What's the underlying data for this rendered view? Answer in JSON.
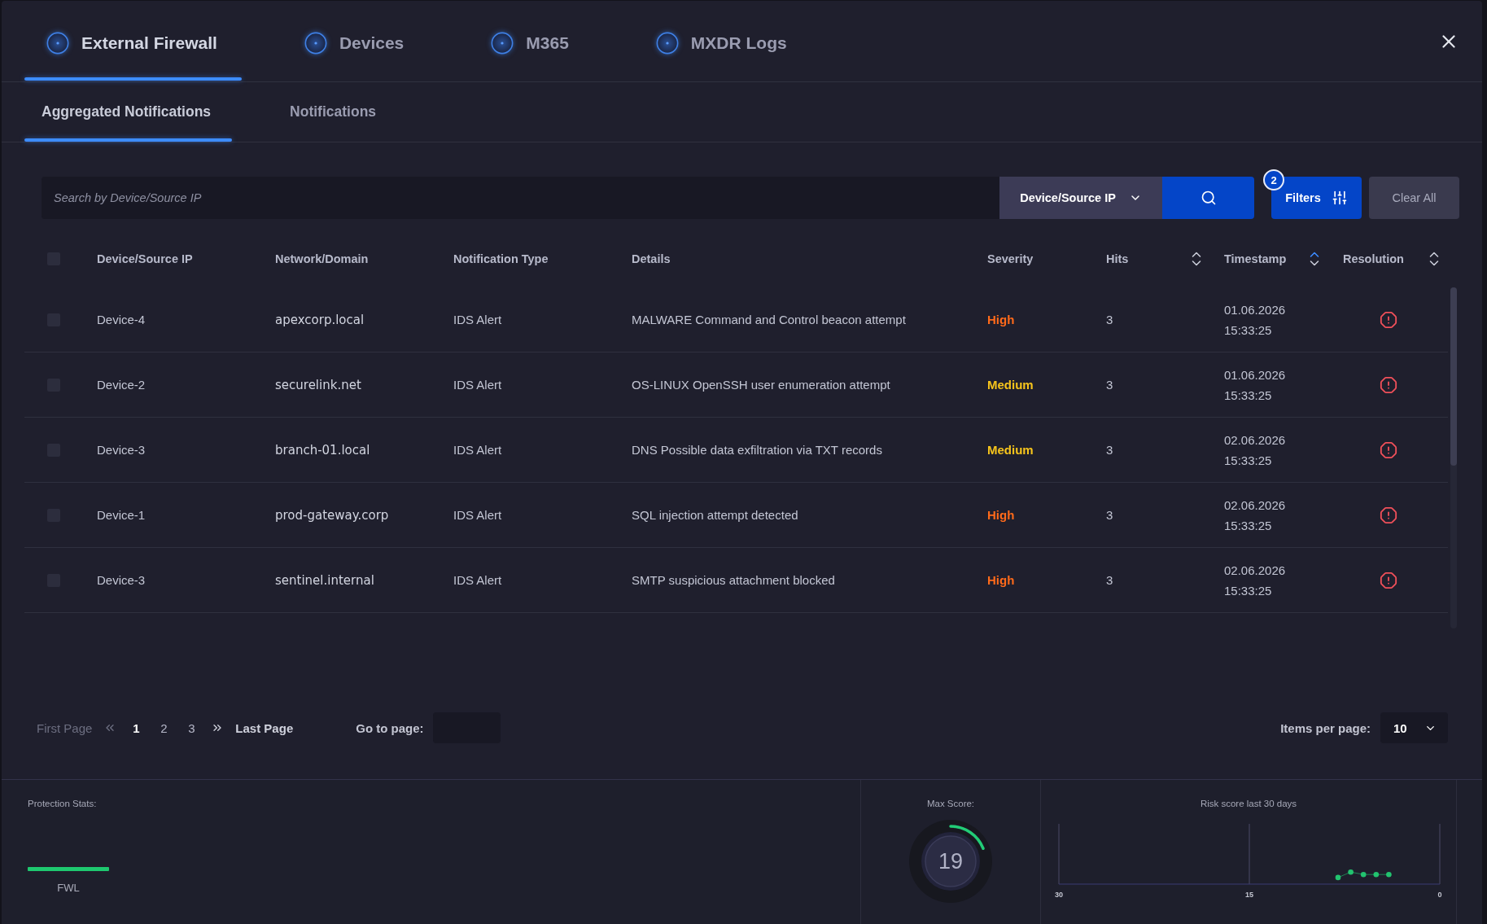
{
  "tabs": [
    {
      "label": "External Firewall",
      "selected": true
    },
    {
      "label": "Devices",
      "selected": false
    },
    {
      "label": "M365",
      "selected": false
    },
    {
      "label": "MXDR Logs",
      "selected": false
    }
  ],
  "subtabs": [
    {
      "label": "Aggregated Notifications",
      "selected": true
    },
    {
      "label": "Notifications",
      "selected": false
    }
  ],
  "search": {
    "placeholder": "Search by Device/Source IP",
    "field_select": "Device/Source IP"
  },
  "filters": {
    "label": "Filters",
    "count": "2"
  },
  "clear_button": "Clear All",
  "table": {
    "select_all": {
      "checked": false
    },
    "columns": [
      {
        "label": "Device/Source IP",
        "sortable": false
      },
      {
        "label": "Network/Domain",
        "sortable": false
      },
      {
        "label": "Notification Type",
        "sortable": false
      },
      {
        "label": "Details",
        "sortable": false
      },
      {
        "label": "Severity",
        "sortable": false
      },
      {
        "label": "Hits",
        "sortable": true,
        "sorted": false
      },
      {
        "label": "Timestamp",
        "sortable": true,
        "sorted": true
      },
      {
        "label": "Resolution",
        "sortable": true,
        "sorted": false
      }
    ],
    "rows": [
      {
        "checked": false,
        "device": "Device-4",
        "domain": "apexcorp.local",
        "type": "IDS Alert",
        "details": "MALWARE Command and Control beacon attempt",
        "severity": {
          "label": "High",
          "color": "#ff6a1a"
        },
        "hits": "3",
        "date": "01.06.2026",
        "time": "15:33:25",
        "resolved": false
      },
      {
        "checked": false,
        "device": "Device-2",
        "domain": "securelink.net",
        "type": "IDS Alert",
        "details": "OS-LINUX OpenSSH user enumeration attempt",
        "severity": {
          "label": "Medium",
          "color": "#f7c51c"
        },
        "hits": "3",
        "date": "01.06.2026",
        "time": "15:33:25",
        "resolved": false
      },
      {
        "checked": false,
        "device": "Device-3",
        "domain": "branch-01.local",
        "type": "IDS Alert",
        "details": "DNS Possible data exfiltration via TXT records",
        "severity": {
          "label": "Medium",
          "color": "#f7c51c"
        },
        "hits": "3",
        "date": "02.06.2026",
        "time": "15:33:25",
        "resolved": false
      },
      {
        "checked": false,
        "device": "Device-1",
        "domain": "prod-gateway.corp",
        "type": "IDS Alert",
        "details": "SQL injection attempt detected",
        "severity": {
          "label": "High",
          "color": "#ff6a1a"
        },
        "hits": "3",
        "date": "02.06.2026",
        "time": "15:33:25",
        "resolved": false
      },
      {
        "checked": false,
        "device": "Device-3",
        "domain": "sentinel.internal",
        "type": "IDS Alert",
        "details": "SMTP suspicious attachment blocked",
        "severity": {
          "label": "High",
          "color": "#ff6a1a"
        },
        "hits": "3",
        "date": "02.06.2026",
        "time": "15:33:25",
        "resolved": false
      }
    ]
  },
  "pagination": {
    "first": {
      "label": "First Page",
      "disabled": true
    },
    "pages": [
      {
        "label": "1",
        "selected": true
      },
      {
        "label": "2",
        "selected": false
      },
      {
        "label": "3",
        "selected": false
      }
    ],
    "last": {
      "label": "Last Page",
      "disabled": false
    },
    "goto_label": "Go to page:",
    "per_page_label": "Items per page:",
    "per_page_value": "10"
  },
  "protection_stats": {
    "title": "Protection Stats:",
    "items": [
      {
        "label": "FWL"
      }
    ]
  },
  "max_score": {
    "title": "Max Score:",
    "value": "19",
    "level": 0.19
  },
  "risk_chart": {
    "title": "Risk score last 30 days",
    "axis_labels": [
      "30",
      "15",
      "0"
    ]
  }
}
